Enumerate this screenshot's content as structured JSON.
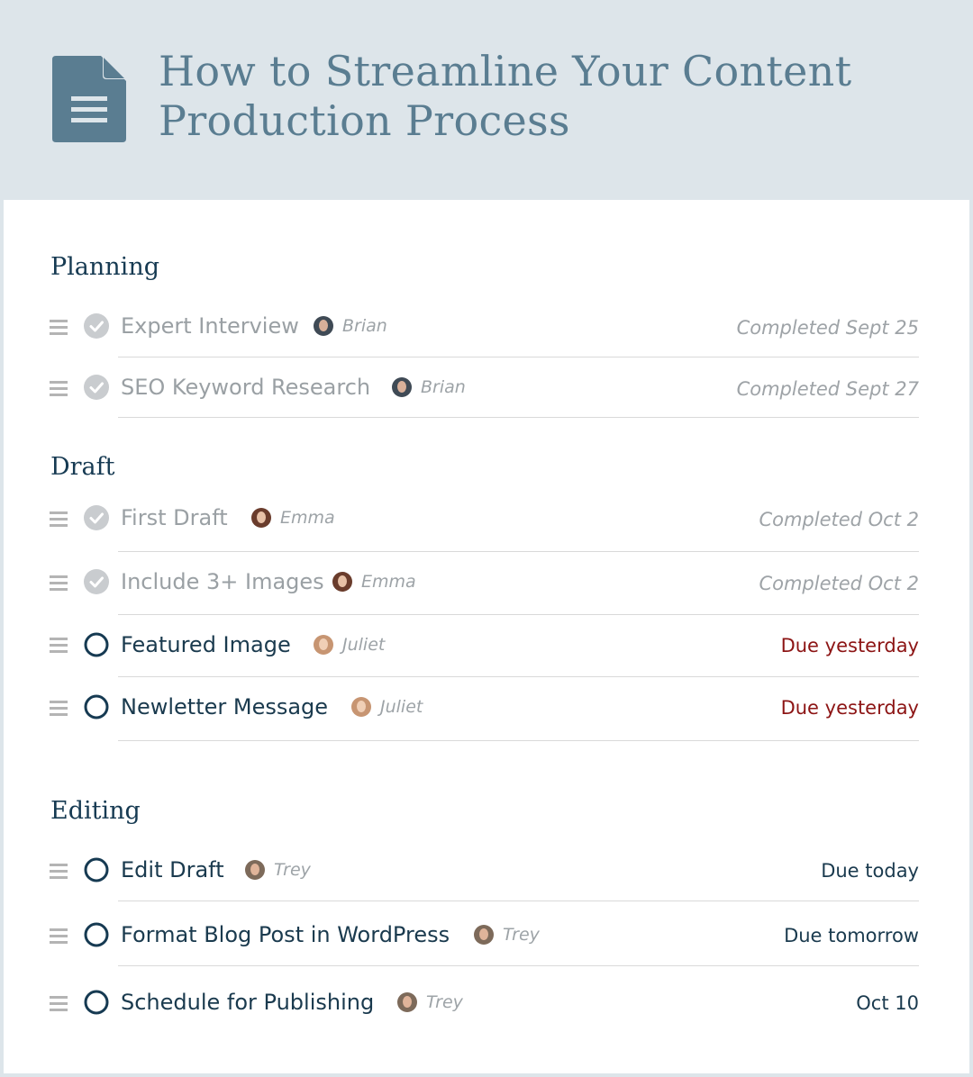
{
  "page": {
    "title_line1": "How to Streamline Your Content",
    "title_line2": "Production Process",
    "icon": "document-icon"
  },
  "colors": {
    "header_bg": "#dde5ea",
    "title": "#5a7d91",
    "section_title": "#163a52",
    "task_open": "#1a3a4e",
    "task_done": "#9aa0a4",
    "overdue": "#8c1414"
  },
  "sections": [
    {
      "title": "Planning",
      "tasks": [
        {
          "label": "Expert Interview",
          "assignee": "Brian",
          "status": "Completed Sept 25",
          "done": true
        },
        {
          "label": "SEO Keyword Research",
          "assignee": "Brian",
          "status": "Completed Sept 27",
          "done": true
        }
      ]
    },
    {
      "title": "Draft",
      "tasks": [
        {
          "label": "First Draft",
          "assignee": "Emma",
          "status": "Completed Oct 2",
          "done": true
        },
        {
          "label": "Include 3+ Images",
          "assignee": "Emma",
          "status": "Completed Oct 2",
          "done": true
        },
        {
          "label": "Featured Image",
          "assignee": "Juliet",
          "status": "Due yesterday",
          "done": false
        },
        {
          "label": "Newletter Message",
          "assignee": "Juliet",
          "status": "Due yesterday",
          "done": false
        }
      ]
    },
    {
      "title": "Editing",
      "tasks": [
        {
          "label": "Edit Draft",
          "assignee": "Trey",
          "status": "Due today",
          "done": false
        },
        {
          "label": "Format Blog Post in WordPress",
          "assignee": "Trey",
          "status": "Due tomorrow",
          "done": false
        },
        {
          "label": "Schedule for Publishing",
          "assignee": "Trey",
          "status": "Oct 10",
          "done": false
        }
      ]
    }
  ]
}
